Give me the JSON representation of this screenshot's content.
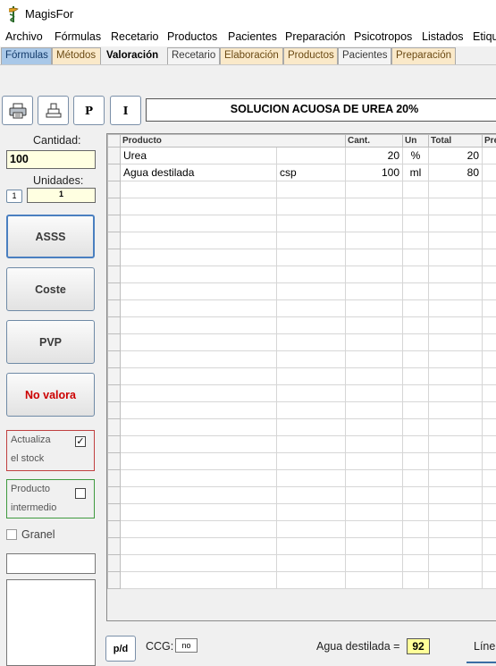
{
  "app": {
    "title": "MagisFor",
    "icon": "caduceus-logo-icon"
  },
  "menu": [
    "Archivo",
    "Fórmulas",
    "Recetario",
    "Productos",
    "Pacientes",
    "Preparación",
    "Psicotropos",
    "Listados",
    "Etiqu"
  ],
  "tabs": [
    "Fórmulas",
    "Métodos",
    "Valoración",
    "Recetario",
    "Elaboración",
    "Productos",
    "Pacientes",
    "Preparación"
  ],
  "active_tab": "Valoración",
  "toolbar": {
    "print_icon": "printer-icon",
    "label_icon": "stamp-icon",
    "p_label": "P",
    "i_label": "I",
    "formula_title": "SOLUCION ACUOSA DE UREA 20%"
  },
  "left": {
    "cantidad_label": "Cantidad:",
    "cantidad_value": "100",
    "unidades_label": "Unidades:",
    "unidades_step": "1",
    "unidades_value": "1",
    "btn_asss": "ASSS",
    "btn_coste": "Coste",
    "btn_pvp": "PVP",
    "btn_no_valora": "No valora",
    "actualiza_line1": "Actualiza",
    "actualiza_line2": "el stock",
    "actualiza_checked": "✓",
    "intermedio_line1": "Producto",
    "intermedio_line2": "intermedio",
    "granel_label": "Granel"
  },
  "table": {
    "headers": [
      "Producto",
      "Cant.",
      "Un",
      "Total",
      "Pre"
    ],
    "rows": [
      {
        "producto": "Urea",
        "extra": "",
        "cant": "20",
        "un": "%",
        "total": "20"
      },
      {
        "producto": "Agua destilada",
        "extra": "csp",
        "cant": "100",
        "un": "ml",
        "total": "80"
      }
    ]
  },
  "bottom": {
    "pd_label": "p/d",
    "ccg_label": "CCG:",
    "ccg_value": "no",
    "agua_label": "Agua destilada =",
    "agua_value": "92",
    "lineas_label": "Líne"
  },
  "colors": {
    "tab_blue": "#a9c8e8",
    "tab_orange": "#fae9c9",
    "no_valora": "#cc0000",
    "actualiza_border": "#c04040",
    "intermedio_border": "#3f9a3f",
    "total_highlight": "#ffff99"
  }
}
